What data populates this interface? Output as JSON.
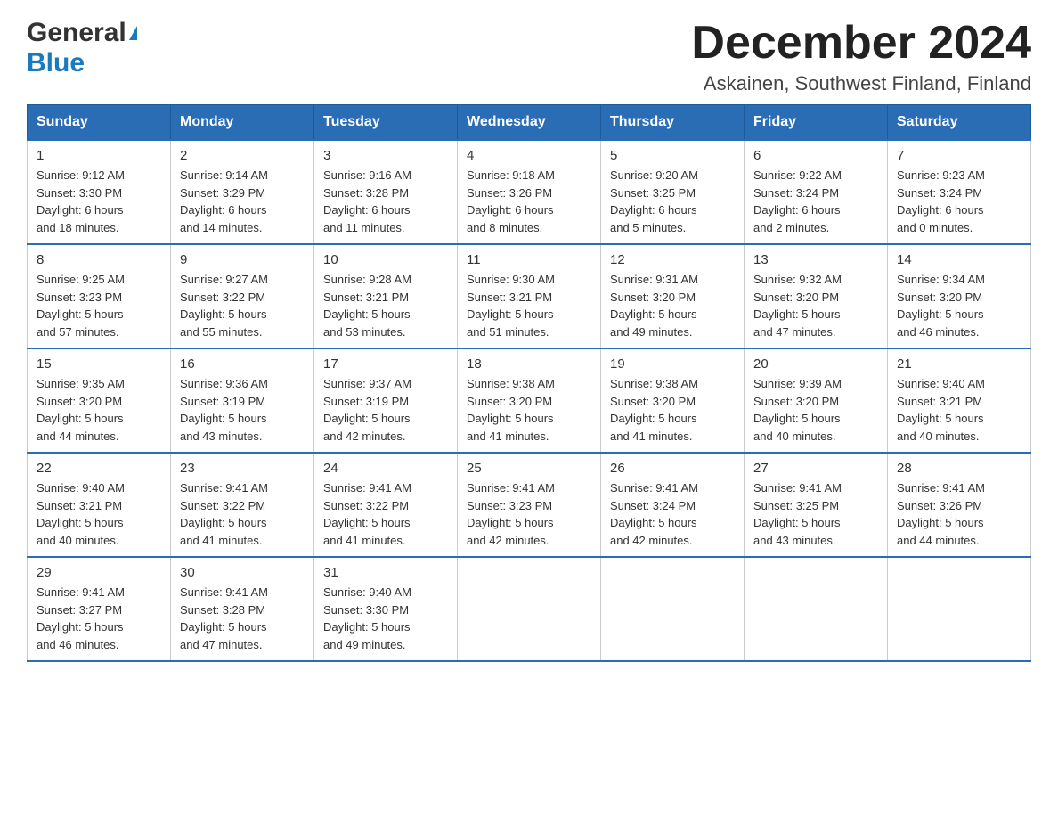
{
  "header": {
    "logo_general": "General",
    "logo_blue": "Blue",
    "month_title": "December 2024",
    "location": "Askainen, Southwest Finland, Finland"
  },
  "days_of_week": [
    "Sunday",
    "Monday",
    "Tuesday",
    "Wednesday",
    "Thursday",
    "Friday",
    "Saturday"
  ],
  "weeks": [
    [
      {
        "day": "1",
        "sunrise": "Sunrise: 9:12 AM",
        "sunset": "Sunset: 3:30 PM",
        "daylight": "Daylight: 6 hours",
        "daylight2": "and 18 minutes."
      },
      {
        "day": "2",
        "sunrise": "Sunrise: 9:14 AM",
        "sunset": "Sunset: 3:29 PM",
        "daylight": "Daylight: 6 hours",
        "daylight2": "and 14 minutes."
      },
      {
        "day": "3",
        "sunrise": "Sunrise: 9:16 AM",
        "sunset": "Sunset: 3:28 PM",
        "daylight": "Daylight: 6 hours",
        "daylight2": "and 11 minutes."
      },
      {
        "day": "4",
        "sunrise": "Sunrise: 9:18 AM",
        "sunset": "Sunset: 3:26 PM",
        "daylight": "Daylight: 6 hours",
        "daylight2": "and 8 minutes."
      },
      {
        "day": "5",
        "sunrise": "Sunrise: 9:20 AM",
        "sunset": "Sunset: 3:25 PM",
        "daylight": "Daylight: 6 hours",
        "daylight2": "and 5 minutes."
      },
      {
        "day": "6",
        "sunrise": "Sunrise: 9:22 AM",
        "sunset": "Sunset: 3:24 PM",
        "daylight": "Daylight: 6 hours",
        "daylight2": "and 2 minutes."
      },
      {
        "day": "7",
        "sunrise": "Sunrise: 9:23 AM",
        "sunset": "Sunset: 3:24 PM",
        "daylight": "Daylight: 6 hours",
        "daylight2": "and 0 minutes."
      }
    ],
    [
      {
        "day": "8",
        "sunrise": "Sunrise: 9:25 AM",
        "sunset": "Sunset: 3:23 PM",
        "daylight": "Daylight: 5 hours",
        "daylight2": "and 57 minutes."
      },
      {
        "day": "9",
        "sunrise": "Sunrise: 9:27 AM",
        "sunset": "Sunset: 3:22 PM",
        "daylight": "Daylight: 5 hours",
        "daylight2": "and 55 minutes."
      },
      {
        "day": "10",
        "sunrise": "Sunrise: 9:28 AM",
        "sunset": "Sunset: 3:21 PM",
        "daylight": "Daylight: 5 hours",
        "daylight2": "and 53 minutes."
      },
      {
        "day": "11",
        "sunrise": "Sunrise: 9:30 AM",
        "sunset": "Sunset: 3:21 PM",
        "daylight": "Daylight: 5 hours",
        "daylight2": "and 51 minutes."
      },
      {
        "day": "12",
        "sunrise": "Sunrise: 9:31 AM",
        "sunset": "Sunset: 3:20 PM",
        "daylight": "Daylight: 5 hours",
        "daylight2": "and 49 minutes."
      },
      {
        "day": "13",
        "sunrise": "Sunrise: 9:32 AM",
        "sunset": "Sunset: 3:20 PM",
        "daylight": "Daylight: 5 hours",
        "daylight2": "and 47 minutes."
      },
      {
        "day": "14",
        "sunrise": "Sunrise: 9:34 AM",
        "sunset": "Sunset: 3:20 PM",
        "daylight": "Daylight: 5 hours",
        "daylight2": "and 46 minutes."
      }
    ],
    [
      {
        "day": "15",
        "sunrise": "Sunrise: 9:35 AM",
        "sunset": "Sunset: 3:20 PM",
        "daylight": "Daylight: 5 hours",
        "daylight2": "and 44 minutes."
      },
      {
        "day": "16",
        "sunrise": "Sunrise: 9:36 AM",
        "sunset": "Sunset: 3:19 PM",
        "daylight": "Daylight: 5 hours",
        "daylight2": "and 43 minutes."
      },
      {
        "day": "17",
        "sunrise": "Sunrise: 9:37 AM",
        "sunset": "Sunset: 3:19 PM",
        "daylight": "Daylight: 5 hours",
        "daylight2": "and 42 minutes."
      },
      {
        "day": "18",
        "sunrise": "Sunrise: 9:38 AM",
        "sunset": "Sunset: 3:20 PM",
        "daylight": "Daylight: 5 hours",
        "daylight2": "and 41 minutes."
      },
      {
        "day": "19",
        "sunrise": "Sunrise: 9:38 AM",
        "sunset": "Sunset: 3:20 PM",
        "daylight": "Daylight: 5 hours",
        "daylight2": "and 41 minutes."
      },
      {
        "day": "20",
        "sunrise": "Sunrise: 9:39 AM",
        "sunset": "Sunset: 3:20 PM",
        "daylight": "Daylight: 5 hours",
        "daylight2": "and 40 minutes."
      },
      {
        "day": "21",
        "sunrise": "Sunrise: 9:40 AM",
        "sunset": "Sunset: 3:21 PM",
        "daylight": "Daylight: 5 hours",
        "daylight2": "and 40 minutes."
      }
    ],
    [
      {
        "day": "22",
        "sunrise": "Sunrise: 9:40 AM",
        "sunset": "Sunset: 3:21 PM",
        "daylight": "Daylight: 5 hours",
        "daylight2": "and 40 minutes."
      },
      {
        "day": "23",
        "sunrise": "Sunrise: 9:41 AM",
        "sunset": "Sunset: 3:22 PM",
        "daylight": "Daylight: 5 hours",
        "daylight2": "and 41 minutes."
      },
      {
        "day": "24",
        "sunrise": "Sunrise: 9:41 AM",
        "sunset": "Sunset: 3:22 PM",
        "daylight": "Daylight: 5 hours",
        "daylight2": "and 41 minutes."
      },
      {
        "day": "25",
        "sunrise": "Sunrise: 9:41 AM",
        "sunset": "Sunset: 3:23 PM",
        "daylight": "Daylight: 5 hours",
        "daylight2": "and 42 minutes."
      },
      {
        "day": "26",
        "sunrise": "Sunrise: 9:41 AM",
        "sunset": "Sunset: 3:24 PM",
        "daylight": "Daylight: 5 hours",
        "daylight2": "and 42 minutes."
      },
      {
        "day": "27",
        "sunrise": "Sunrise: 9:41 AM",
        "sunset": "Sunset: 3:25 PM",
        "daylight": "Daylight: 5 hours",
        "daylight2": "and 43 minutes."
      },
      {
        "day": "28",
        "sunrise": "Sunrise: 9:41 AM",
        "sunset": "Sunset: 3:26 PM",
        "daylight": "Daylight: 5 hours",
        "daylight2": "and 44 minutes."
      }
    ],
    [
      {
        "day": "29",
        "sunrise": "Sunrise: 9:41 AM",
        "sunset": "Sunset: 3:27 PM",
        "daylight": "Daylight: 5 hours",
        "daylight2": "and 46 minutes."
      },
      {
        "day": "30",
        "sunrise": "Sunrise: 9:41 AM",
        "sunset": "Sunset: 3:28 PM",
        "daylight": "Daylight: 5 hours",
        "daylight2": "and 47 minutes."
      },
      {
        "day": "31",
        "sunrise": "Sunrise: 9:40 AM",
        "sunset": "Sunset: 3:30 PM",
        "daylight": "Daylight: 5 hours",
        "daylight2": "and 49 minutes."
      },
      null,
      null,
      null,
      null
    ]
  ]
}
